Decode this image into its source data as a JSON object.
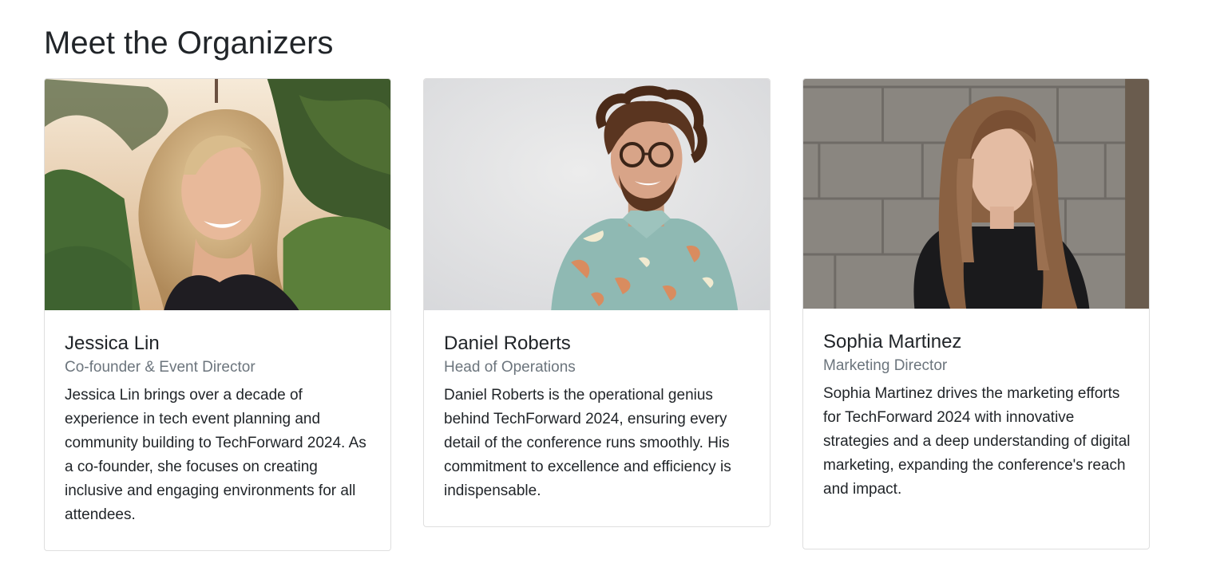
{
  "section": {
    "title": "Meet the Organizers"
  },
  "organizers": [
    {
      "name": "Jessica Lin",
      "role": "Co-founder & Event Director",
      "bio": "Jessica Lin brings over a decade of experience in tech event planning and community building to TechForward 2024. As a co-founder, she focuses on creating inclusive and engaging environments for all attendees.",
      "photo": "woman-smiling-outdoors-portrait"
    },
    {
      "name": "Daniel Roberts",
      "role": "Head of Operations",
      "bio": "Daniel Roberts is the operational genius behind TechForward 2024, ensuring every detail of the conference runs smoothly. His commitment to excellence and efficiency is indispensable.",
      "photo": "man-with-glasses-studio-portrait"
    },
    {
      "name": "Sophia Martinez",
      "role": "Marketing Director",
      "bio": "Sophia Martinez drives the marketing efforts for TechForward 2024 with innovative strategies and a deep understanding of digital marketing, expanding the conference's reach and impact.",
      "photo": "woman-against-brick-wall-portrait"
    }
  ],
  "colors": {
    "text": "#212529",
    "muted": "#6c757d",
    "border": "#dfdfdf"
  }
}
